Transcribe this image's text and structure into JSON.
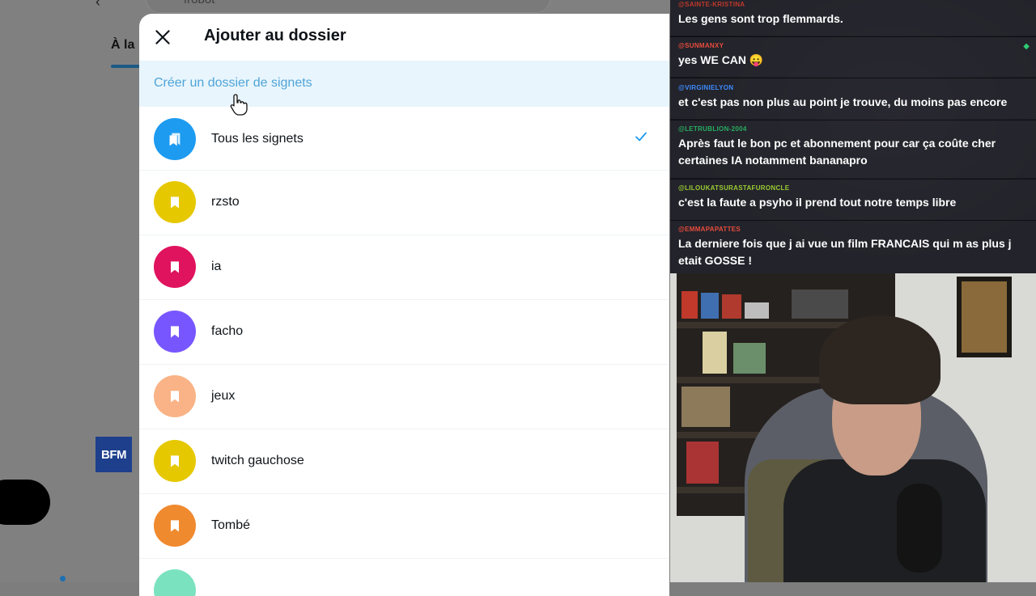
{
  "background_page": {
    "search_value": "frobot",
    "tab_label": "À la",
    "logo_text": "BFM"
  },
  "modal": {
    "title": "Ajouter au dossier",
    "create_link": "Créer un dossier de signets",
    "folders": [
      {
        "label": "Tous les signets",
        "color": "#1d9bf0",
        "selected": true
      },
      {
        "label": "rzsto",
        "color": "#e6c800",
        "selected": false
      },
      {
        "label": "ia",
        "color": "#e0135e",
        "selected": false
      },
      {
        "label": "facho",
        "color": "#7856ff",
        "selected": false
      },
      {
        "label": "jeux",
        "color": "#f9b386",
        "selected": false
      },
      {
        "label": "twitch gauchose",
        "color": "#e6c800",
        "selected": false
      },
      {
        "label": "Tombé",
        "color": "#f08a2f",
        "selected": false
      }
    ]
  },
  "chat": {
    "messages": [
      {
        "user": "@SAINTE-KRISTINA",
        "user_color": "#c0392b",
        "text": "Les gens sont trop flemmards."
      },
      {
        "user": "@SUNMANXY",
        "user_color": "#e74c3c",
        "text": "yes WE CAN 😛"
      },
      {
        "user": "@VIRGINIELYON",
        "user_color": "#3d8bfd",
        "text": "et c'est pas non plus au point je trouve, du moins pas encore"
      },
      {
        "user": "@LETRUBLION-2004",
        "user_color": "#27ae60",
        "text": "Après faut le bon pc et abonnement pour car ça coûte cher certaines IA notamment bananapro"
      },
      {
        "user": "@LILOUKATSURASTAFURONCLE",
        "user_color": "#9acd32",
        "text": "c'est la faute a psyho il prend tout notre temps libre"
      },
      {
        "user": "@EMMAPAPATTES",
        "user_color": "#e74c3c",
        "text": "La derniere fois que j ai vue un film FRANCAIS qui m as plus j etait GOSSE !"
      }
    ]
  }
}
